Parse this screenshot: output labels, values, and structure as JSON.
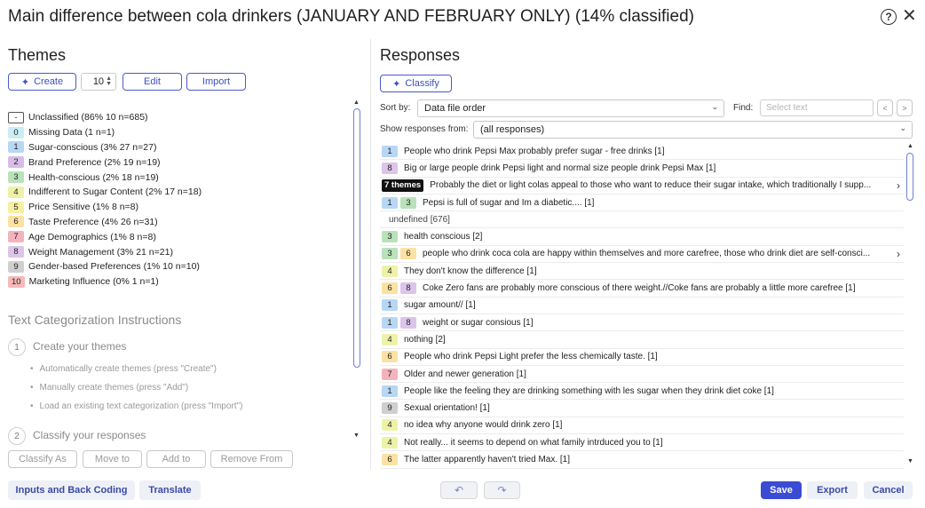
{
  "window": {
    "title": "Main difference between cola drinkers (JANUARY AND FEBRUARY ONLY) (14% classified)"
  },
  "themes_panel": {
    "heading": "Themes",
    "create_label": "Create",
    "count_value": "10",
    "edit_label": "Edit",
    "import_label": "Import",
    "themes": [
      {
        "badge": "-",
        "color": "#ffffff",
        "label": "Unclassified (86% 10 n=685)"
      },
      {
        "badge": "0",
        "color": "#c9eef3",
        "label": "Missing Data (1 n=1)"
      },
      {
        "badge": "1",
        "color": "#b7d7f5",
        "label": "Sugar-conscious (3% 27 n=27)"
      },
      {
        "badge": "2",
        "color": "#d6bde8",
        "label": "Brand Preference (2% 19 n=19)"
      },
      {
        "badge": "3",
        "color": "#b9e2bb",
        "label": "Health-conscious (2% 18 n=19)"
      },
      {
        "badge": "4",
        "color": "#eef2a8",
        "label": "Indifferent to Sugar Content (2% 17 n=18)"
      },
      {
        "badge": "5",
        "color": "#f7f0a1",
        "label": "Price Sensitive (1% 8 n=8)"
      },
      {
        "badge": "6",
        "color": "#fbe2a3",
        "label": "Taste Preference (4% 26 n=31)"
      },
      {
        "badge": "7",
        "color": "#f3b3bd",
        "label": "Age Demographics (1% 8 n=8)"
      },
      {
        "badge": "8",
        "color": "#dcc4ea",
        "label": "Weight Management (3% 21 n=21)"
      },
      {
        "badge": "9",
        "color": "#cfcfcf",
        "label": "Gender-based Preferences (1% 10 n=10)"
      },
      {
        "badge": "10",
        "color": "#f6b9b9",
        "label": "Marketing Influence (0% 1 n=1)"
      }
    ],
    "instructions": {
      "title": "Text Categorization Instructions",
      "step1_num": "1",
      "step1_label": "Create your themes",
      "bullets": [
        "Automatically create themes (press \"Create\")",
        "Manually create themes (press \"Add\")",
        "Load an existing text categorization (press \"Import\")"
      ],
      "step2_num": "2",
      "step2_label": "Classify your responses"
    },
    "actions": {
      "classify_as": "Classify As",
      "move_to": "Move to",
      "add_to": "Add to",
      "remove_from": "Remove From"
    }
  },
  "responses_panel": {
    "heading": "Responses",
    "classify_label": "Classify",
    "sort_label": "Sort by:",
    "sort_value": "Data file order",
    "find_label": "Find:",
    "find_placeholder": "Select text",
    "show_from_label": "Show responses from:",
    "show_from_value": "(all responses)",
    "responses": [
      {
        "badges": [
          {
            "t": "1",
            "c": "#b7d7f5"
          }
        ],
        "text": "People who drink Pepsi Max probably prefer sugar - free drinks [1]"
      },
      {
        "badges": [
          {
            "t": "8",
            "c": "#dcc4ea"
          }
        ],
        "text": "Big or large people drink Pepsi light and normal size people drink Pepsi Max [1]"
      },
      {
        "badges": [
          {
            "t": "7 themes",
            "c": "#111111",
            "dark": true
          }
        ],
        "text": "Probably the diet or light colas appeal to those who want to reduce their sugar intake, which traditionally I supp...",
        "more": true
      },
      {
        "badges": [
          {
            "t": "1",
            "c": "#b7d7f5"
          },
          {
            "t": "3",
            "c": "#b9e2bb"
          }
        ],
        "text": "Pepsi is full of sugar and Im a diabetic.... [1]"
      },
      {
        "badges": [],
        "text": "undefined [676]"
      },
      {
        "badges": [
          {
            "t": "3",
            "c": "#b9e2bb"
          }
        ],
        "text": "health conscious [2]"
      },
      {
        "badges": [
          {
            "t": "3",
            "c": "#b9e2bb"
          },
          {
            "t": "6",
            "c": "#fbe2a3"
          }
        ],
        "text": "people who drink coca cola are happy within themselves and more carefree, those who drink diet are self-consci...",
        "more": true
      },
      {
        "badges": [
          {
            "t": "4",
            "c": "#eef2a8"
          }
        ],
        "text": "They don't know the difference [1]"
      },
      {
        "badges": [
          {
            "t": "6",
            "c": "#fbe2a3"
          },
          {
            "t": "8",
            "c": "#dcc4ea"
          }
        ],
        "text": "Coke Zero fans are probably more conscious of there weight.//Coke fans are probably a little more carefree [1]"
      },
      {
        "badges": [
          {
            "t": "1",
            "c": "#b7d7f5"
          }
        ],
        "text": "sugar amount// [1]"
      },
      {
        "badges": [
          {
            "t": "1",
            "c": "#b7d7f5"
          },
          {
            "t": "8",
            "c": "#dcc4ea"
          }
        ],
        "text": "weight or sugar consious [1]"
      },
      {
        "badges": [
          {
            "t": "4",
            "c": "#eef2a8"
          }
        ],
        "text": "nothing [2]"
      },
      {
        "badges": [
          {
            "t": "6",
            "c": "#fbe2a3"
          }
        ],
        "text": "People who drink Pepsi Light prefer the less chemically taste. [1]"
      },
      {
        "badges": [
          {
            "t": "7",
            "c": "#f3b3bd"
          }
        ],
        "text": "Older and newer generation [1]"
      },
      {
        "badges": [
          {
            "t": "1",
            "c": "#b7d7f5"
          }
        ],
        "text": "People like the feeling they are drinking something with les sugar when they drink diet coke [1]"
      },
      {
        "badges": [
          {
            "t": "9",
            "c": "#cfcfcf"
          }
        ],
        "text": "Sexual orientation! [1]"
      },
      {
        "badges": [
          {
            "t": "4",
            "c": "#eef2a8"
          }
        ],
        "text": "no idea why anyone would drink zero [1]"
      },
      {
        "badges": [
          {
            "t": "4",
            "c": "#eef2a8"
          }
        ],
        "text": "Not really... it seems to depend on what family intrduced you to [1]"
      },
      {
        "badges": [
          {
            "t": "6",
            "c": "#fbe2a3"
          }
        ],
        "text": "The latter apparently haven't tried Max. [1]"
      }
    ]
  },
  "footer": {
    "inputs_back_coding": "Inputs and Back Coding",
    "translate": "Translate",
    "undo_icon": "↶",
    "redo_icon": "↷",
    "save": "Save",
    "export": "Export",
    "cancel": "Cancel"
  },
  "colors": {
    "accent": "#3a4bd4",
    "accent_text": "#3b4fc4"
  }
}
